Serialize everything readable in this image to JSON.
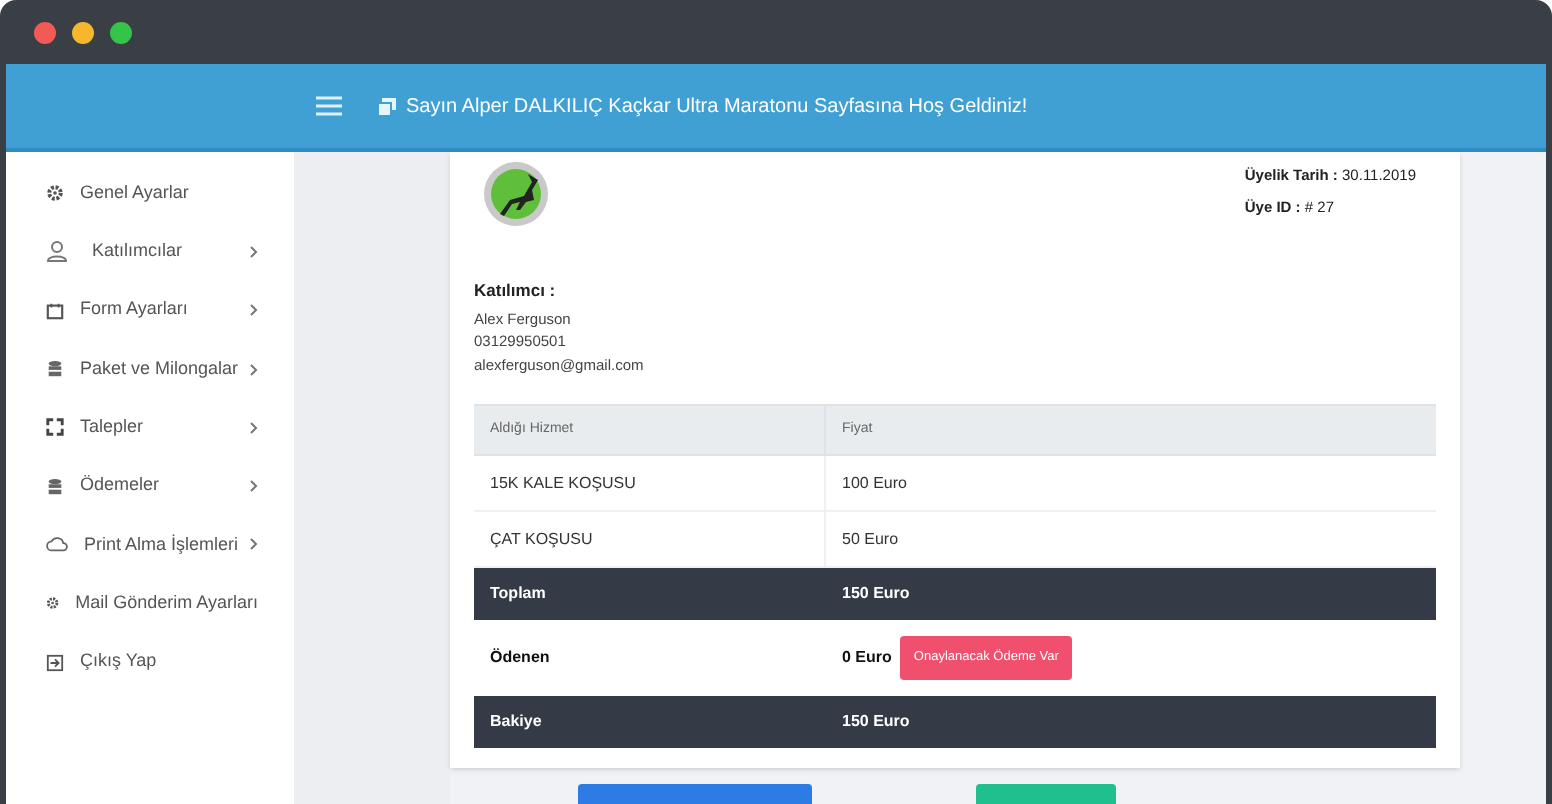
{
  "header": {
    "welcome": "Sayın Alper DALKILIÇ Kaçkar Ultra Maratonu Sayfasına Hoş Geldiniz!"
  },
  "sidebar": {
    "items": [
      {
        "label": "Genel Ayarlar",
        "has_submenu": false
      },
      {
        "label": "Katılımcılar",
        "has_submenu": true
      },
      {
        "label": "Form Ayarları",
        "has_submenu": true
      },
      {
        "label": "Paket ve Milongalar",
        "has_submenu": true
      },
      {
        "label": "Talepler",
        "has_submenu": true
      },
      {
        "label": "Ödemeler",
        "has_submenu": true
      },
      {
        "label": "Print Alma İşlemleri",
        "has_submenu": true
      },
      {
        "label": "Mail Gönderim Ayarları",
        "has_submenu": false
      },
      {
        "label": "Çıkış Yap",
        "has_submenu": false
      }
    ]
  },
  "invoice": {
    "meta": [
      {
        "label": "Üyelik Tarih :",
        "value": "30.11.2019"
      },
      {
        "label": "Üye ID :",
        "value": "# 27"
      }
    ],
    "participant": {
      "heading": "Katılımcı :",
      "lines": [
        "Alex Ferguson",
        "03129950501",
        "alexferguson@gmail.com"
      ]
    },
    "table": {
      "columns": [
        "Aldığı Hizmet",
        "Fiyat"
      ],
      "rows": [
        {
          "kind": "item",
          "service": "15K KALE KOŞUSU",
          "price": "100 Euro"
        },
        {
          "kind": "item",
          "service": "ÇAT KOŞUSU",
          "price": "50 Euro"
        },
        {
          "kind": "total",
          "service": "Toplam",
          "price": "150 Euro"
        },
        {
          "kind": "paid",
          "service": "Ödenen",
          "price": "0 Euro",
          "badge": "Onaylanacak Ödeme Var"
        },
        {
          "kind": "total",
          "service": "Bakiye",
          "price": "150 Euro"
        }
      ]
    },
    "footer_buttons": [
      {
        "color": "#2d7be5"
      },
      {
        "color": "#1fc08e"
      }
    ]
  }
}
